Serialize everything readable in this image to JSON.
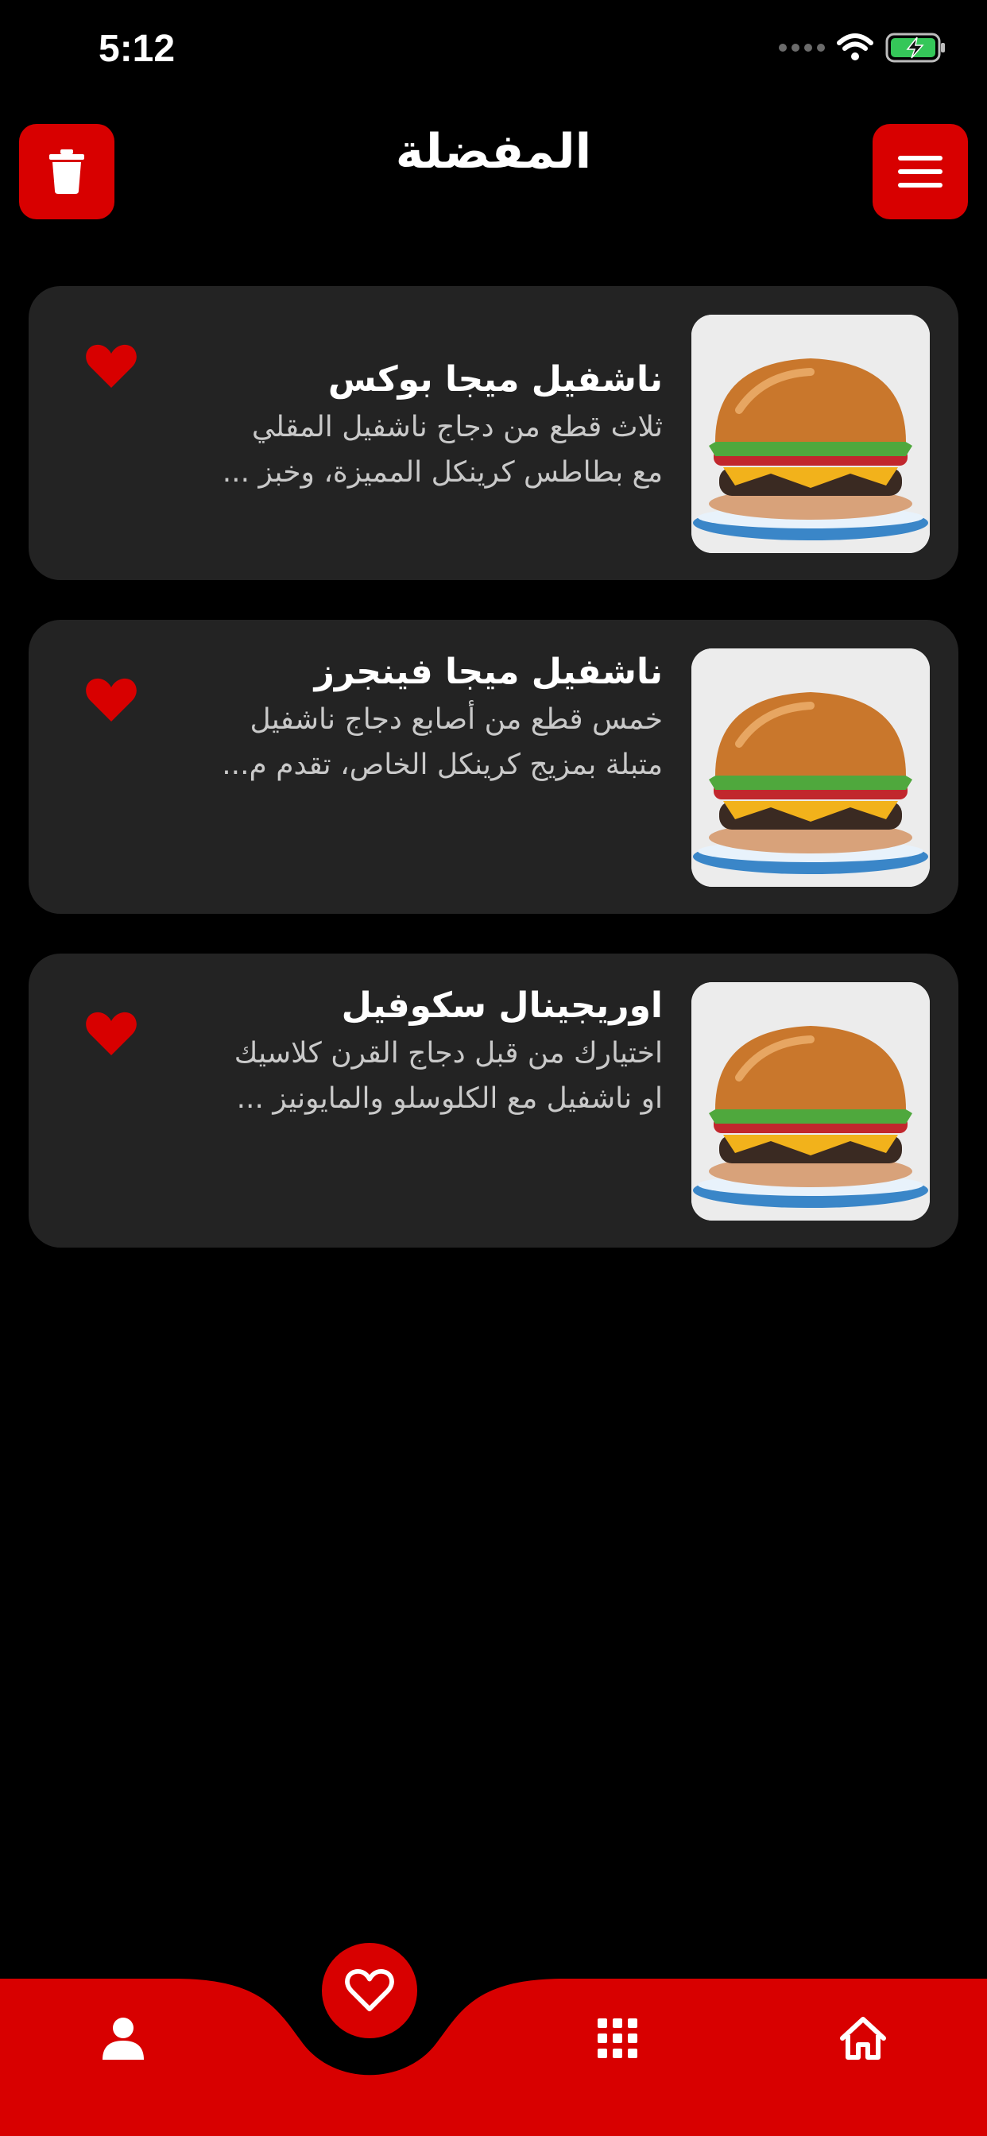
{
  "status_bar": {
    "time": "5:12"
  },
  "header": {
    "title": "المفضلة"
  },
  "favorites": [
    {
      "title": "ناشفيل ميجا بوكس",
      "desc_line1": "ثلاث قطع من دجاج ناشفيل المقلي",
      "desc_line2": "مع بطاطس كرينكل المميزة، وخبز ..."
    },
    {
      "title": "ناشفيل ميجا فينجرز",
      "desc_line1": "خمس قطع من أصابع دجاج ناشفيل",
      "desc_line2": "متبلة بمزيج كرينكل الخاص، تقدم م..."
    },
    {
      "title": "اوريجينال سكوفيل",
      "desc_line1": "اختيارك من قبل دجاج القرن كلاسيك",
      "desc_line2": "او ناشفيل مع الكلوسلو والمايونيز ..."
    }
  ],
  "colors": {
    "accent": "#d80000",
    "card_bg": "#232323",
    "background": "#000000"
  },
  "icons": {
    "header_left": "trash-icon",
    "header_right": "hamburger-menu-icon",
    "card_action": "heart-icon",
    "nav": [
      "profile-icon",
      "heart-icon",
      "grid-icon",
      "home-icon"
    ]
  }
}
